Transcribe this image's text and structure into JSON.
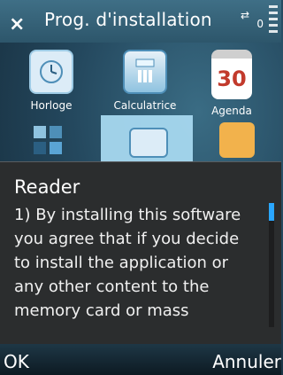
{
  "title_bar": {
    "title": "Prog. d'installation",
    "close_glyph": "×",
    "net_glyph": "⇄",
    "battery_label": "0"
  },
  "apps": [
    {
      "label": "Horloge",
      "icon": "clock-icon"
    },
    {
      "label": "Calculatrice",
      "icon": "calculator-icon"
    },
    {
      "label": "Agenda",
      "icon": "calendar-icon",
      "number": "30"
    }
  ],
  "dialog": {
    "title": "Reader",
    "body": "1) By installing this software you agree that if you decide to install the application or any other content to the memory card or mass"
  },
  "softkeys": {
    "left": "OK",
    "right": "Annuler"
  },
  "colors": {
    "accent": "#2aa7ff",
    "highlight": "#a7d8ef",
    "dialog_bg": "#2b2d2e"
  }
}
